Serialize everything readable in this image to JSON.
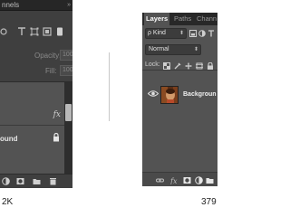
{
  "left": {
    "tab_text": "nnels",
    "collapse_glyph": "»",
    "opacity_label": "Opacity:",
    "opacity_value": "100%",
    "fill_label": "Fill:",
    "fill_value": "100%",
    "fx_label": "fx",
    "layer_name": "ound",
    "icons": [
      "link-icon",
      "text-layer-icon",
      "transform-icon",
      "artboard-icon",
      "smart-object-icon"
    ],
    "bottom_icons": [
      "adjustment-icon",
      "mask-icon",
      "folder-icon",
      "trash-icon"
    ],
    "caption": "2K"
  },
  "right": {
    "tabs": [
      "Layers",
      "Paths",
      "Chann"
    ],
    "kind_label": "ρ Kind",
    "kind_arrows": "⬍",
    "blend_mode": "Normal",
    "blend_arrows": "⬍",
    "lock_label": "Lock:",
    "layer_name": "Backgroun",
    "bottom_icons": [
      "link-icon",
      "fx-icon",
      "mask-icon",
      "adjustment-icon",
      "folder-icon"
    ],
    "caption": "379"
  },
  "colors": {
    "panel_dark": "#3f3f3f",
    "panel_mid": "#535353",
    "tabbar": "#282828",
    "text_light": "#e6e6e6"
  }
}
